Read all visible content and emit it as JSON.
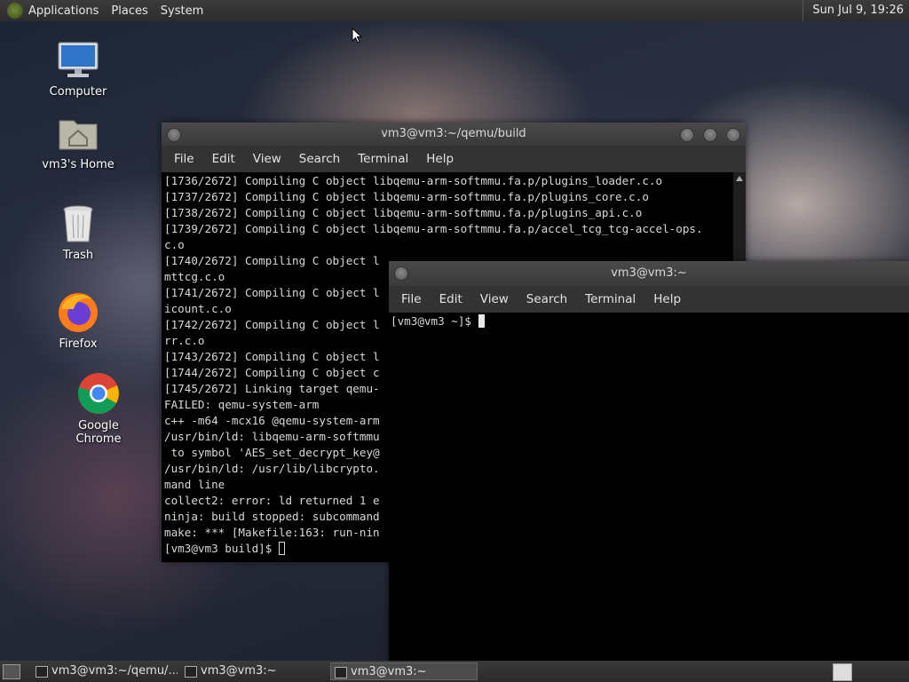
{
  "top_panel": {
    "menus": [
      "Applications",
      "Places",
      "System"
    ],
    "clock": "Sun Jul  9, 19:26"
  },
  "desktop_icons": [
    {
      "label": "Computer",
      "icon": "computer-icon"
    },
    {
      "label": "vm3's Home",
      "icon": "home-folder-icon"
    },
    {
      "label": "Trash",
      "icon": "trash-icon"
    },
    {
      "label": "Firefox",
      "icon": "firefox-icon"
    },
    {
      "label": "Google Chrome",
      "icon": "chrome-icon"
    }
  ],
  "terminal_back": {
    "title": "vm3@vm3:~/qemu/build",
    "menu": [
      "File",
      "Edit",
      "View",
      "Search",
      "Terminal",
      "Help"
    ],
    "lines": [
      "[1736/2672] Compiling C object libqemu-arm-softmmu.fa.p/plugins_loader.c.o",
      "[1737/2672] Compiling C object libqemu-arm-softmmu.fa.p/plugins_core.c.o",
      "[1738/2672] Compiling C object libqemu-arm-softmmu.fa.p/plugins_api.c.o",
      "[1739/2672] Compiling C object libqemu-arm-softmmu.fa.p/accel_tcg_tcg-accel-ops.",
      "c.o",
      "[1740/2672] Compiling C object l",
      "mttcg.c.o",
      "[1741/2672] Compiling C object l",
      "icount.c.o",
      "[1742/2672] Compiling C object l",
      "rr.c.o",
      "[1743/2672] Compiling C object l",
      "[1744/2672] Compiling C object c",
      "[1745/2672] Linking target qemu-",
      "FAILED: qemu-system-arm",
      "c++ -m64 -mcx16 @qemu-system-arm",
      "/usr/bin/ld: libqemu-arm-softmmu",
      " to symbol 'AES_set_decrypt_key@",
      "/usr/bin/ld: /usr/lib/libcrypto.",
      "mand line",
      "collect2: error: ld returned 1 e",
      "ninja: build stopped: subcommand",
      "make: *** [Makefile:163: run-nin"
    ],
    "prompt": "[vm3@vm3 build]$ "
  },
  "terminal_front": {
    "title": "vm3@vm3:~",
    "menu": [
      "File",
      "Edit",
      "View",
      "Search",
      "Terminal",
      "Help"
    ],
    "prompt": "[vm3@vm3 ~]$ "
  },
  "taskbar": {
    "tasks": [
      {
        "label": "vm3@vm3:~/qemu/...",
        "active": false
      },
      {
        "label": "vm3@vm3:~",
        "active": false
      },
      {
        "label": "vm3@vm3:~",
        "active": true
      }
    ]
  },
  "colors": {
    "terminal_bg": "#000000",
    "terminal_fg": "#d8d8d8",
    "panel_bg": "#2c2c2c"
  }
}
